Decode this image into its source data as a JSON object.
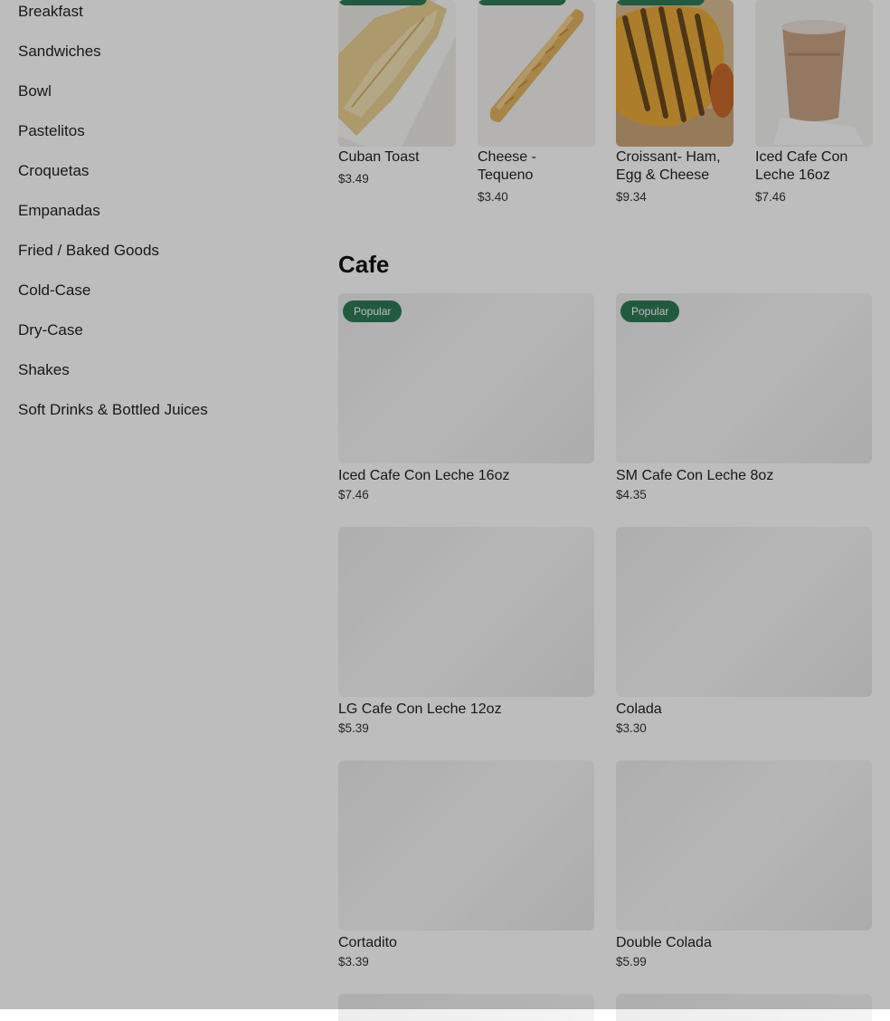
{
  "sidebar": {
    "items": [
      {
        "label": "Breakfast"
      },
      {
        "label": "Sandwiches"
      },
      {
        "label": "Bowl"
      },
      {
        "label": "Pastelitos"
      },
      {
        "label": "Croquetas"
      },
      {
        "label": "Empanadas"
      },
      {
        "label": "Fried / Baked Goods"
      },
      {
        "label": "Cold-Case"
      },
      {
        "label": "Dry-Case"
      },
      {
        "label": "Shakes"
      },
      {
        "label": "Soft Drinks & Bottled Juices"
      }
    ]
  },
  "top_items": [
    {
      "name": "Cuban Toast",
      "price": "$3.49",
      "image_icon": "cuban-toast-photo"
    },
    {
      "name": "Cheese - Tequeno",
      "price": "$3.40",
      "image_icon": "tequeno-photo"
    },
    {
      "name": "Croissant- Ham, Egg & Cheese",
      "price": "$9.34",
      "image_icon": "croissant-photo"
    },
    {
      "name": "Iced Cafe Con Leche 16oz",
      "price": "$7.46",
      "image_icon": "iced-coffee-photo"
    }
  ],
  "section": {
    "title": "Cafe"
  },
  "cafe_items": [
    {
      "name": "Iced Cafe Con Leche 16oz",
      "price": "$7.46",
      "badge": "Popular"
    },
    {
      "name": "SM Cafe Con Leche 8oz",
      "price": "$4.35",
      "badge": "Popular"
    },
    {
      "name": "LG Cafe Con Leche 12oz",
      "price": "$5.39"
    },
    {
      "name": "Colada",
      "price": "$3.30"
    },
    {
      "name": "Cortadito",
      "price": "$3.39"
    },
    {
      "name": "Double Colada",
      "price": "$5.99"
    }
  ],
  "colors": {
    "badge": "#2f7a55",
    "overlay": "rgba(0,0,0,0.26)"
  }
}
